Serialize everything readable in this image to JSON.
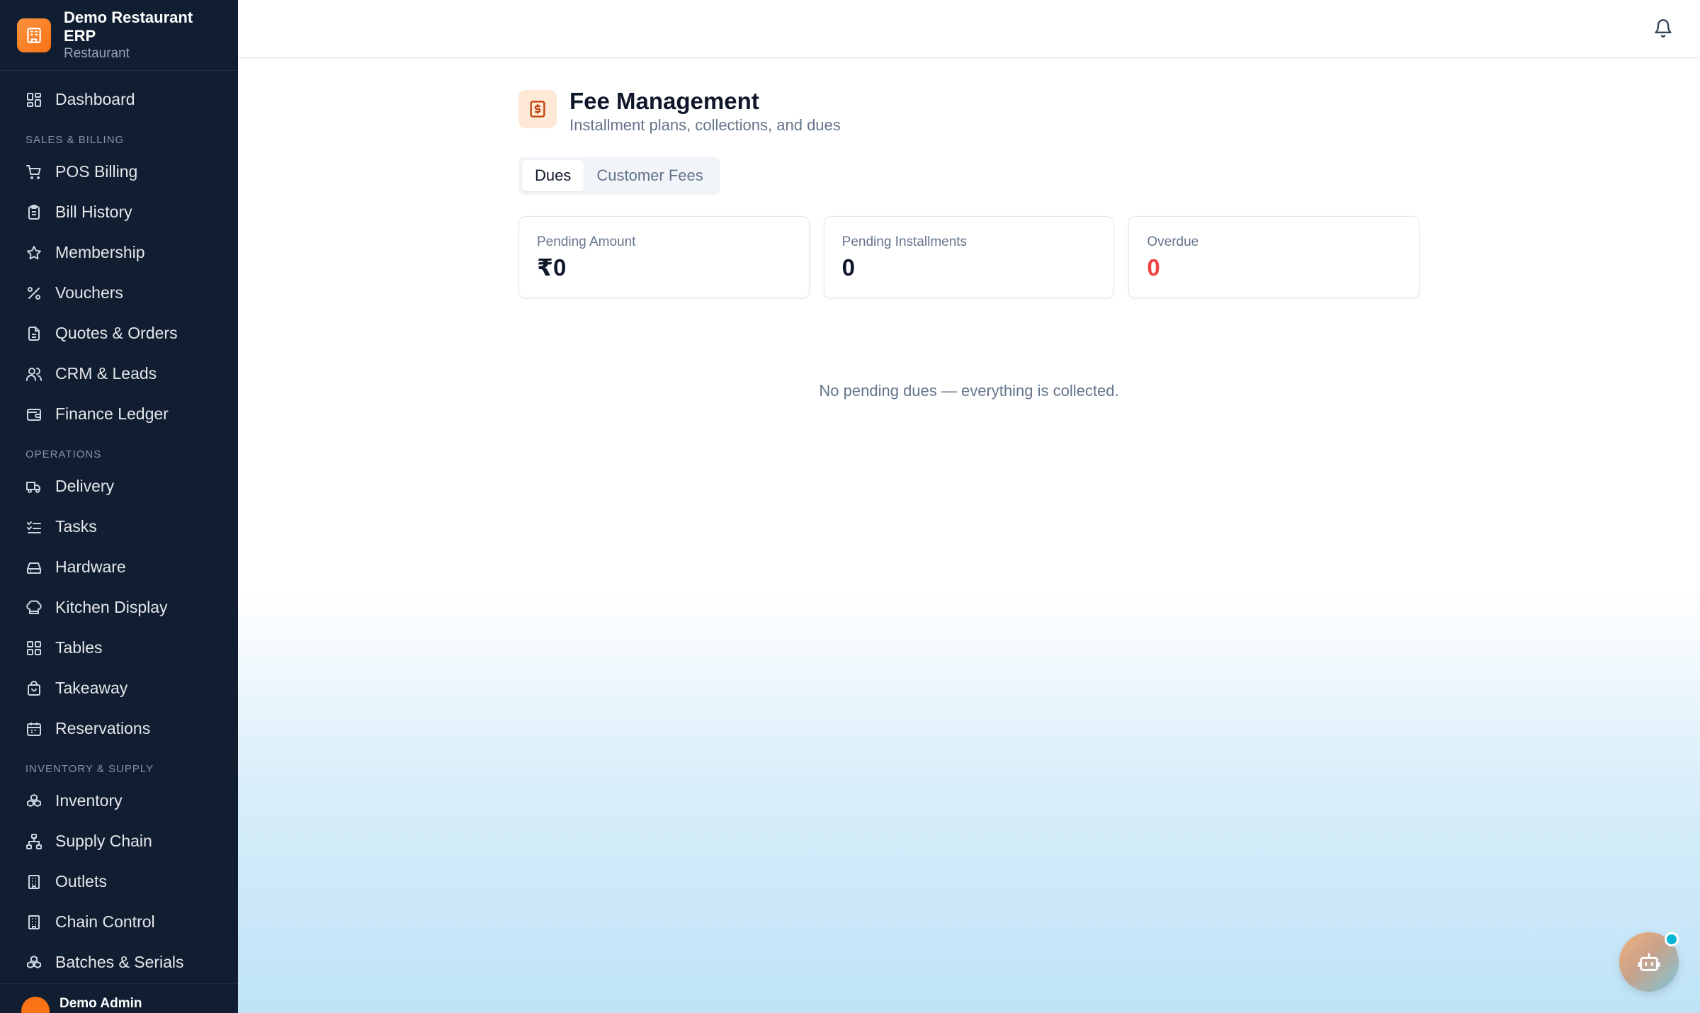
{
  "brand": {
    "title": "Demo Restaurant ERP",
    "subtitle": "Restaurant"
  },
  "sidebar": {
    "dashboard": "Dashboard",
    "sections": [
      {
        "title": "SALES & BILLING",
        "items": [
          "POS Billing",
          "Bill History",
          "Membership",
          "Vouchers",
          "Quotes & Orders",
          "CRM & Leads",
          "Finance Ledger"
        ]
      },
      {
        "title": "OPERATIONS",
        "items": [
          "Delivery",
          "Tasks",
          "Hardware",
          "Kitchen Display",
          "Tables",
          "Takeaway",
          "Reservations"
        ]
      },
      {
        "title": "INVENTORY & SUPPLY",
        "items": [
          "Inventory",
          "Supply Chain",
          "Outlets",
          "Chain Control",
          "Batches & Serials"
        ]
      }
    ],
    "footer_user": "Demo Admin"
  },
  "page": {
    "title": "Fee Management",
    "subtitle": "Installment plans, collections, and dues",
    "tabs": [
      {
        "label": "Dues",
        "active": true
      },
      {
        "label": "Customer Fees",
        "active": false
      }
    ],
    "stats": [
      {
        "label": "Pending Amount",
        "value": "₹0"
      },
      {
        "label": "Pending Installments",
        "value": "0"
      },
      {
        "label": "Overdue",
        "value": "0"
      }
    ],
    "empty_message": "No pending dues — everything is collected."
  },
  "colors": {
    "sidebar_bg": "#111e31",
    "accent": "#f97316",
    "danger": "#ef4444",
    "assistant_dot": "#06b6d4"
  },
  "icons": {
    "brand": "building-icon",
    "notifications": "bell-icon",
    "page": "fee-receipt-icon",
    "assistant": "bot-icon"
  }
}
